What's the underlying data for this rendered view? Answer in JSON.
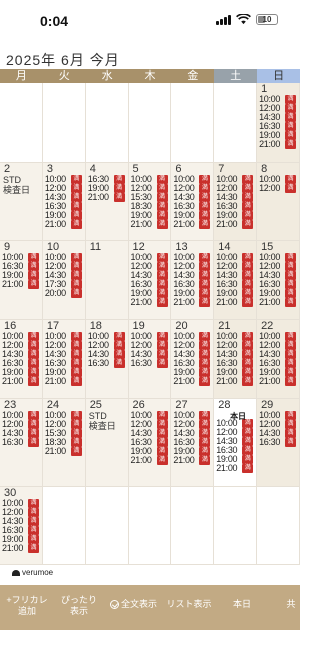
{
  "status": {
    "time": "0:04",
    "battery": "10"
  },
  "header": {
    "title": "2025年 6月 今月"
  },
  "weekdays": [
    "月",
    "火",
    "水",
    "木",
    "金",
    "土",
    "日"
  ],
  "badge_text": "満",
  "today_label": "本日",
  "days": {
    "d1": {
      "num": "1",
      "slots": [
        "10:00",
        "12:00",
        "14:30",
        "16:30",
        "19:00",
        "21:00"
      ]
    },
    "d2": {
      "num": "2",
      "note": [
        "STD",
        "検査日"
      ]
    },
    "d3": {
      "num": "3",
      "slots": [
        "10:00",
        "12:00",
        "14:30",
        "16:30",
        "19:00",
        "21:00"
      ]
    },
    "d4": {
      "num": "4",
      "slots": [
        "16:30",
        "19:00",
        "21:00"
      ]
    },
    "d5": {
      "num": "5",
      "slots": [
        "10:00",
        "12:00",
        "15:30",
        "18:30",
        "19:00",
        "21:00"
      ]
    },
    "d6": {
      "num": "6",
      "slots": [
        "10:00",
        "12:00",
        "14:30",
        "16:30",
        "19:00",
        "21:00"
      ]
    },
    "d7": {
      "num": "7",
      "slots": [
        "10:00",
        "12:00",
        "14:30",
        "16:30",
        "19:00",
        "21:00"
      ]
    },
    "d8": {
      "num": "8",
      "slots": [
        "10:00",
        "12:00"
      ]
    },
    "d9": {
      "num": "9",
      "slots": [
        "10:00",
        "16:30",
        "19:00",
        "21:00"
      ]
    },
    "d10": {
      "num": "10",
      "slots": [
        "10:00",
        "12:00",
        "14:30",
        "17:30",
        "20:00"
      ]
    },
    "d11": {
      "num": "11"
    },
    "d12": {
      "num": "12",
      "slots": [
        "10:00",
        "12:00",
        "14:30",
        "16:30",
        "19:00",
        "21:00"
      ]
    },
    "d13": {
      "num": "13",
      "slots": [
        "10:00",
        "12:00",
        "14:30",
        "16:30",
        "19:00",
        "21:00"
      ]
    },
    "d14": {
      "num": "14",
      "slots": [
        "10:00",
        "12:00",
        "14:30",
        "16:30",
        "19:00",
        "21:00"
      ]
    },
    "d15": {
      "num": "15",
      "slots": [
        "10:00",
        "12:00",
        "14:30",
        "16:30",
        "19:00",
        "21:00"
      ]
    },
    "d16": {
      "num": "16",
      "slots": [
        "10:00",
        "12:00",
        "14:30",
        "16:30",
        "19:00",
        "21:00"
      ]
    },
    "d17": {
      "num": "17",
      "slots": [
        "10:00",
        "12:00",
        "14:30",
        "16:30",
        "19:00",
        "21:00"
      ]
    },
    "d18": {
      "num": "18",
      "slots": [
        "10:00",
        "12:00",
        "14:30",
        "16:30"
      ]
    },
    "d19": {
      "num": "19",
      "slots": [
        "10:00",
        "12:00",
        "14:30",
        "16:30"
      ]
    },
    "d20": {
      "num": "20",
      "slots": [
        "10:00",
        "12:00",
        "14:30",
        "16:30",
        "19:00",
        "21:00"
      ]
    },
    "d21": {
      "num": "21",
      "slots": [
        "10:00",
        "12:00",
        "14:30",
        "16:30",
        "19:00",
        "21:00"
      ]
    },
    "d22": {
      "num": "22",
      "slots": [
        "10:00",
        "12:00",
        "14:30",
        "16:30",
        "19:00",
        "21:00"
      ]
    },
    "d23": {
      "num": "23",
      "slots": [
        "10:00",
        "12:00",
        "14:30",
        "16:30"
      ]
    },
    "d24": {
      "num": "24",
      "slots": [
        "10:00",
        "12:00",
        "15:30",
        "18:30",
        "21:00"
      ]
    },
    "d25": {
      "num": "25",
      "note": [
        "STD",
        "検査日"
      ]
    },
    "d26": {
      "num": "26",
      "slots": [
        "10:00",
        "12:00",
        "14:30",
        "16:30",
        "19:00",
        "21:00"
      ]
    },
    "d27": {
      "num": "27",
      "slots": [
        "10:00",
        "12:00",
        "14:30",
        "16:30",
        "19:00",
        "21:00"
      ]
    },
    "d28": {
      "num": "28",
      "slots": [
        "10:00",
        "12:00",
        "14:30",
        "16:30",
        "19:00",
        "21:00"
      ]
    },
    "d29": {
      "num": "29",
      "slots": [
        "10:00",
        "12:00",
        "14:30",
        "16:30"
      ]
    },
    "d30": {
      "num": "30",
      "slots": [
        "10:00",
        "12:00",
        "14:30",
        "16:30",
        "19:00",
        "21:00"
      ]
    }
  },
  "logo": "verumoe",
  "toolbar": {
    "furikae": "+フリカレ 追加",
    "fit": "ぴったり 表示",
    "full": "全文表示",
    "list": "リスト表示",
    "today": "本日",
    "share": "共"
  }
}
